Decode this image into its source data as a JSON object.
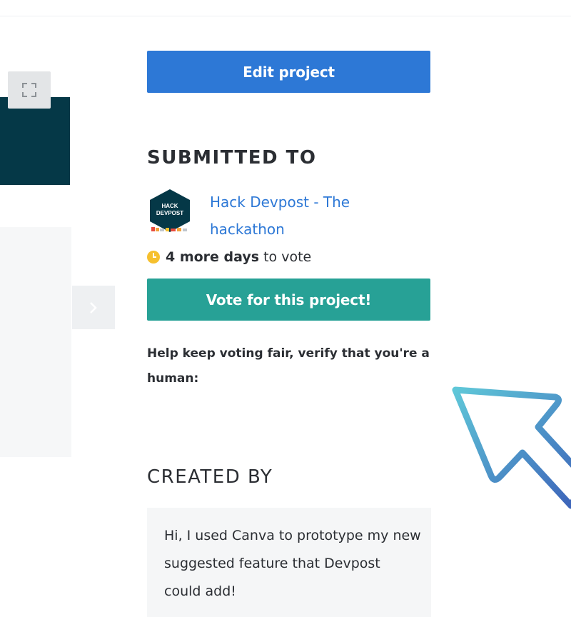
{
  "gallery": {
    "expand_icon": "expand-icon",
    "next_icon": "chevron-right-icon"
  },
  "sidebar": {
    "edit_button_label": "Edit project",
    "submitted_heading": "SUBMITTED TO",
    "hackathon": {
      "name": "Hack Devpost - The hackathon",
      "logo_text_line1": "HACK",
      "logo_text_line2": "DEVPOST"
    },
    "deadline": {
      "icon": "clock-icon",
      "bold_text": "4 more days",
      "rest_text": "to vote"
    },
    "vote_button_label": "Vote for this project!",
    "verify_text": "Help keep voting fair, verify that you're a human:",
    "created_heading": "CREATED BY",
    "created_description": "Hi, I used Canva to prototype my new suggested feature that Devpost could add!"
  },
  "overlay": {
    "cursor_icon": "cursor-arrow-icon"
  },
  "colors": {
    "primary_blue": "#2d78d6",
    "vote_green": "#27a196",
    "dark_teal": "#053847",
    "clock_yellow": "#f6c02e"
  }
}
